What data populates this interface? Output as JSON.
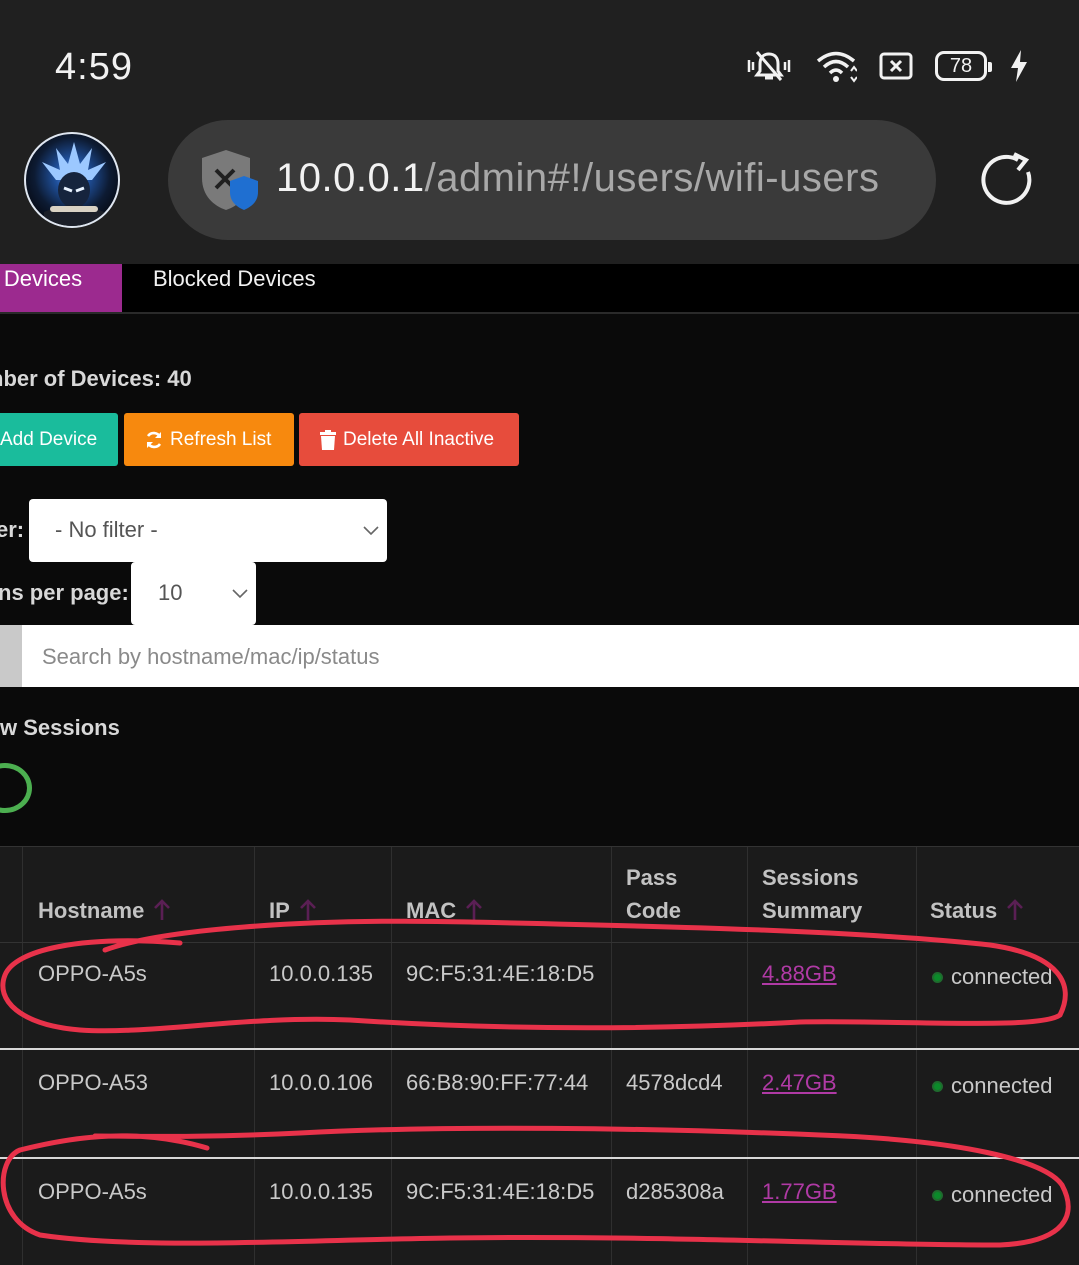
{
  "status_bar": {
    "time": "4:59",
    "battery": "78"
  },
  "browser": {
    "url_host": "10.0.0.1",
    "url_path": "/admin#!/users/wifi-users"
  },
  "tabs": {
    "active": "ll Devices",
    "other": "Blocked Devices"
  },
  "device_count_label": "nber of Devices: 40",
  "buttons": {
    "add": "Add Device",
    "refresh": "Refresh List",
    "delete": "Delete All Inactive"
  },
  "filter": {
    "label": "er:",
    "value": "- No filter -"
  },
  "per_page": {
    "label": "ns per page:",
    "value": "10"
  },
  "search": {
    "placeholder": "Search by hostname/mac/ip/status"
  },
  "sessions_label": "w Sessions",
  "table": {
    "headers": {
      "hostname": "Hostname",
      "ip": "IP",
      "mac": "MAC",
      "pass_code_1": "Pass",
      "pass_code_2": "Code",
      "sessions_1": "Sessions",
      "sessions_2": "Summary",
      "status": "Status"
    },
    "rows": [
      {
        "hostname": "OPPO-A5s",
        "ip": "10.0.0.135",
        "mac": "9C:F5:31:4E:18:D5",
        "pass_code": "",
        "sessions": "4.88GB",
        "status": "connected"
      },
      {
        "hostname": "OPPO-A53",
        "ip": "10.0.0.106",
        "mac": "66:B8:90:FF:77:44",
        "pass_code": "4578dcd4",
        "sessions": "2.47GB",
        "status": "connected"
      },
      {
        "hostname": "OPPO-A5s",
        "ip": "10.0.0.135",
        "mac": "9C:F5:31:4E:18:D5",
        "pass_code": "d285308a",
        "sessions": "1.77GB",
        "status": "connected"
      }
    ]
  },
  "colors": {
    "accent": "#9c2a8f",
    "add": "#1abc9c",
    "refresh": "#f7890e",
    "delete": "#e74c3c",
    "annotation": "#e8324a"
  }
}
